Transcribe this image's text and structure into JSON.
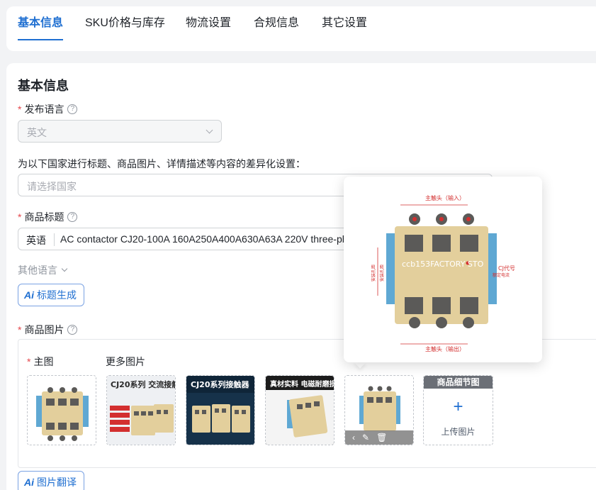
{
  "tabs": [
    {
      "label": "基本信息",
      "active": true
    },
    {
      "label": "SKU价格与库存",
      "active": false
    },
    {
      "label": "物流设置",
      "active": false
    },
    {
      "label": "合规信息",
      "active": false
    },
    {
      "label": "其它设置",
      "active": false
    }
  ],
  "section_title": "基本信息",
  "publish_language": {
    "label": "发布语言",
    "value": "英文"
  },
  "country_diff": {
    "label": "为以下国家进行标题、商品图片、详情描述等内容的差异化设置：",
    "placeholder": "请选择国家"
  },
  "product_title": {
    "label": "商品标题",
    "lang_prefix": "英语",
    "value": "AC contactor CJ20-100A 160A250A400A630A63A 220V three-phase"
  },
  "other_languages": "其他语言",
  "ai_title_button": {
    "ai": "Ai",
    "label": "标题生成"
  },
  "product_images": {
    "label": "商品图片",
    "main_label": "主图",
    "more_label": "更多图片",
    "thumbs": [
      {
        "caption": ""
      },
      {
        "caption": "CJ20系列 交流接触器"
      },
      {
        "caption": "CJ20系列接触器"
      },
      {
        "caption": "真材实料 电磁耐磨损"
      },
      {
        "caption": ""
      }
    ],
    "upload_header": "商品细节图",
    "upload_label": "上传图片"
  },
  "ai_translate_button": {
    "ai": "Ai",
    "label": "图片翻译"
  },
  "popover": {
    "top_label": "主触头（输入）",
    "bottom_label": "主触头（输出）",
    "left_labels": [
      "安装孔距",
      "安装孔距"
    ],
    "right_label": "CJ代号",
    "right_label_2": "额定电流",
    "watermark": "ccb153FACTORY STO"
  },
  "colors": {
    "accent": "#1f6fd1",
    "required": "#e5484d",
    "product_body": "#e3cf9c",
    "product_dark": "#5b5a58",
    "product_blue": "#5fa8d3"
  }
}
